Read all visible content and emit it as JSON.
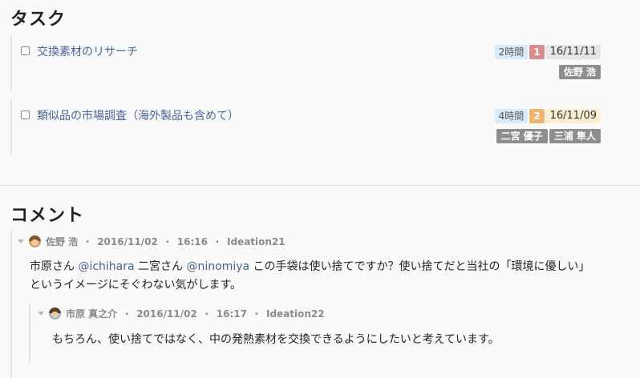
{
  "tasks_section": {
    "title": "タスク",
    "items": [
      {
        "title": "交換素材のリサーチ",
        "estimate": "2時間",
        "priority": "1",
        "due": "16/11/11",
        "assignees": [
          "佐野 浩"
        ]
      },
      {
        "title": "類似品の市場調査（海外製品も含めて）",
        "estimate": "4時間",
        "priority": "2",
        "due": "16/11/09",
        "assignees": [
          "二宮 優子",
          "三浦 隼人"
        ]
      }
    ]
  },
  "comments_section": {
    "title": "コメント",
    "comments": [
      {
        "author": "佐野 浩",
        "date": "2016/11/02",
        "time": "16:16",
        "id": "Ideation21",
        "body": {
          "t1": "市原さん ",
          "m1": "@ichihara",
          "t2": " 二宮さん ",
          "m2": "@ninomiya",
          "t3": " この手袋は使い捨てですか？使い捨てだと当社の「環境に優しい」",
          "line2": "というイメージにそぐわない気がします。"
        }
      },
      {
        "author": "市原 真之介",
        "date": "2016/11/02",
        "time": "16:17",
        "id": "Ideation22",
        "body": "もちろん、使い捨てではなく、中の発熱素材を交換できるようにしたいと考えています。"
      }
    ],
    "separator": "・"
  },
  "colors": {
    "link": "#44659b",
    "priority_1": "#d98c8c",
    "priority_2": "#f0b46e",
    "estimate_bg": "#d7ecfb",
    "assignee_bg": "#8e8e8e"
  }
}
